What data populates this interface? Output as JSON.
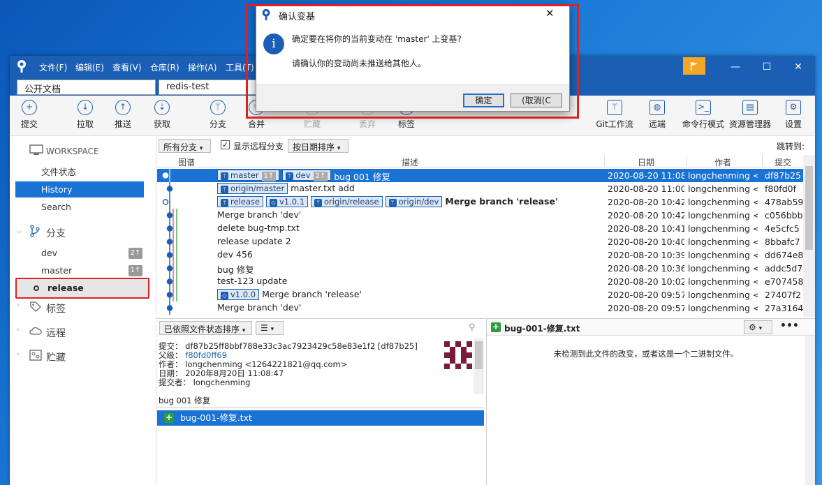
{
  "window": {
    "menus": [
      "文件(F)",
      "编辑(E)",
      "查看(V)",
      "仓库(R)",
      "操作(A)",
      "工具(T)"
    ],
    "tabs": [
      "公开文档",
      "redis-test"
    ],
    "controls": {
      "minimize": "—",
      "maximize": "☐",
      "close": "✕",
      "menu": "☰"
    }
  },
  "toolbar": {
    "left": [
      {
        "label": "提交",
        "icon": "plus-circle-icon",
        "glyph": "+"
      },
      {
        "label": "拉取",
        "icon": "pull-icon",
        "glyph": "↓"
      },
      {
        "label": "推送",
        "icon": "push-icon",
        "glyph": "↑"
      },
      {
        "label": "获取",
        "icon": "fetch-icon",
        "glyph": "⇣"
      },
      {
        "label": "分支",
        "icon": "branch-icon",
        "glyph": "ᛘ"
      },
      {
        "label": "合并",
        "icon": "merge-icon",
        "glyph": "⑂"
      },
      {
        "label": "贮藏",
        "icon": "stash-icon",
        "glyph": "▭"
      },
      {
        "label": "丢弃",
        "icon": "discard-icon",
        "glyph": "↺"
      },
      {
        "label": "标签",
        "icon": "tag-icon",
        "glyph": "◇"
      }
    ],
    "right": [
      {
        "label": "Git工作流",
        "icon": "git-flow-icon",
        "glyph": "ᛘ"
      },
      {
        "label": "远端",
        "icon": "globe-icon",
        "glyph": "◍"
      },
      {
        "label": "命令行模式",
        "icon": "terminal-icon",
        "glyph": ">_"
      },
      {
        "label": "资源管理器",
        "icon": "folder-icon",
        "glyph": "▤"
      },
      {
        "label": "设置",
        "icon": "gear-icon",
        "glyph": "⚙"
      }
    ]
  },
  "sidebar": {
    "workspace": "WORKSPACE",
    "workspace_items": [
      "文件状态",
      "History",
      "Search"
    ],
    "branches_header": "分支",
    "branches": [
      {
        "name": "dev",
        "badge": "2↑"
      },
      {
        "name": "master",
        "badge": "1↑"
      },
      {
        "name": "release",
        "badge": ""
      }
    ],
    "tags_header": "标签",
    "remotes_header": "远程",
    "stashes_header": "贮藏"
  },
  "filter": {
    "branches": "所有分支",
    "show_remote": "显示远程分支",
    "sort": "按日期排序",
    "jump_to": "跳转到:"
  },
  "columns": [
    "图谱",
    "描述",
    "日期",
    "作者",
    "提交"
  ],
  "commits": [
    {
      "refs": [
        {
          "name": "master",
          "count": "1↑"
        },
        {
          "name": "dev",
          "count": "2↑"
        }
      ],
      "message": "bug 001 修复",
      "date": "2020-08-20 11:08",
      "author": "longchenming <",
      "hash": "df87b25"
    },
    {
      "refs": [
        {
          "name": "origin/master"
        }
      ],
      "message": "master.txt add",
      "date": "2020-08-20 11:00",
      "author": "longchenming <",
      "hash": "f80fd0f"
    },
    {
      "refs": [
        {
          "name": "release"
        },
        {
          "name": "v1.0.1"
        },
        {
          "name": "origin/release"
        },
        {
          "name": "origin/dev"
        }
      ],
      "message": "Merge branch 'release'",
      "date": "2020-08-20 10:42",
      "author": "longchenming <",
      "hash": "478ab59"
    },
    {
      "refs": [],
      "message": "Merge branch 'dev'",
      "date": "2020-08-20 10:42",
      "author": "longchenming <",
      "hash": "c056bbb"
    },
    {
      "refs": [],
      "message": "delete bug-tmp.txt",
      "date": "2020-08-20 10:41",
      "author": "longchenming <",
      "hash": "4e5cfc5"
    },
    {
      "refs": [],
      "message": "release update 2",
      "date": "2020-08-20 10:40",
      "author": "longchenming <",
      "hash": "8bbafc7"
    },
    {
      "refs": [],
      "message": "dev 456",
      "date": "2020-08-20 10:39",
      "author": "longchenming <",
      "hash": "dd674e8"
    },
    {
      "refs": [],
      "message": "bug 修复",
      "date": "2020-08-20 10:36",
      "author": "longchenming <",
      "hash": "addc5d7"
    },
    {
      "refs": [],
      "message": "test-123 update",
      "date": "2020-08-20 10:02",
      "author": "longchenming <",
      "hash": "e707458"
    },
    {
      "refs": [
        {
          "name": "v1.0.0"
        }
      ],
      "message": "Merge branch 'release'",
      "date": "2020-08-20 09:57",
      "author": "longchenming <",
      "hash": "27407f2"
    },
    {
      "refs": [],
      "message": "Merge branch 'dev'",
      "date": "2020-08-20 09:57",
      "author": "longchenming <",
      "hash": "27a3164"
    }
  ],
  "details": {
    "sort_drop": "已依照文件状态排序",
    "commit_label": "提交：",
    "commit_value": "df87b25ff8bbf788e33c3ac7923429c58e83e1f2 [df87b25]",
    "parent_label": "父级：",
    "parent_value": "f80fd0ff69",
    "author_label": "作者：",
    "author_value": "longchenming <1264221821@qq.com>",
    "date_label": "日期：",
    "date_value": "2020年8月20日 11:08:47",
    "committer_label": "提交者：",
    "committer_value": "longchenming",
    "message": "bug 001 修复",
    "file": "bug-001-修复.txt"
  },
  "diff": {
    "file": "bug-001-修复.txt",
    "message": "未检测到此文件的改变，或者这是一个二进制文件。"
  },
  "dialog": {
    "title": "确认变基",
    "question": "确定要在将你的当前变动在 'master' 上变基?",
    "note": "请确认你的变动尚未推送给其他人。",
    "ok": "确定",
    "cancel": "(取消(C"
  }
}
